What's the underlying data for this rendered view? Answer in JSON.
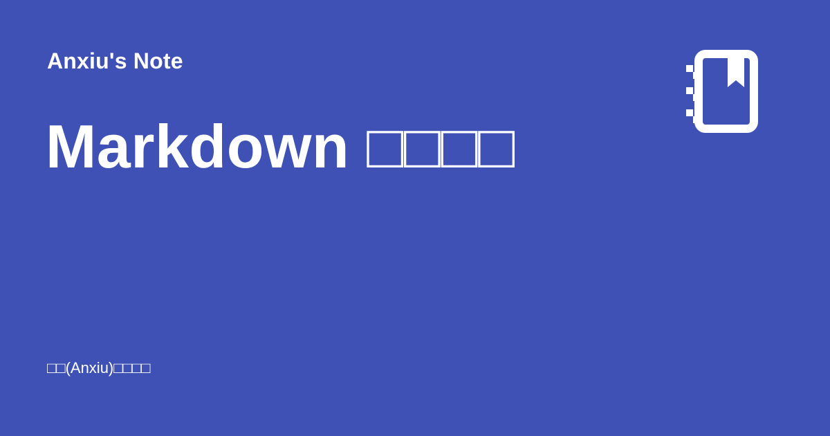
{
  "header": {
    "site_name": "Anxiu's Note",
    "icon": "notebook-bookmark-icon"
  },
  "main": {
    "title": "Markdown □□□□"
  },
  "footer": {
    "text": "□□(Anxiu)□□□□"
  },
  "colors": {
    "background": "#3f51b5",
    "foreground": "#ffffff"
  }
}
